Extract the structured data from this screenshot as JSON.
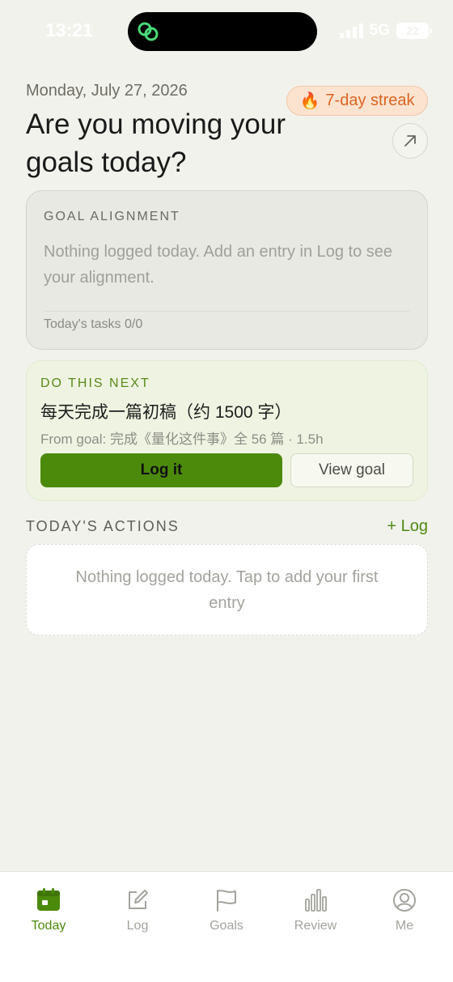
{
  "status_bar": {
    "time": "13:21",
    "network": "5G",
    "battery": "22"
  },
  "header": {
    "date": "Monday, July 27, 2026",
    "headline": "Are you moving your goals today?",
    "streak_emoji": "🔥",
    "streak": "7-day streak"
  },
  "alignment": {
    "title": "GOAL ALIGNMENT",
    "message": "Nothing logged today. Add an entry in Log to see your alignment.",
    "tasks": "Today's tasks 0/0"
  },
  "next": {
    "label": "DO THIS NEXT",
    "task": "每天完成一篇初稿（约 1500 字）",
    "from": "From goal: 完成《量化这件事》全 56 篇 · 1.5h",
    "log_button": "Log it",
    "view_button": "View goal"
  },
  "actions": {
    "title": "TODAY'S ACTIONS",
    "log_link": "+ Log",
    "empty": "Nothing logged today. Tap to add your first entry"
  },
  "tabs": [
    {
      "label": "Today",
      "icon": "calendar-icon",
      "active": true
    },
    {
      "label": "Log",
      "icon": "edit-icon",
      "active": false
    },
    {
      "label": "Goals",
      "icon": "flag-icon",
      "active": false
    },
    {
      "label": "Review",
      "icon": "bar-chart-icon",
      "active": false
    },
    {
      "label": "Me",
      "icon": "user-circle-icon",
      "active": false
    }
  ],
  "colors": {
    "accent": "#4c8a0c",
    "streak": "#d96522",
    "background": "#f2f2ec"
  }
}
